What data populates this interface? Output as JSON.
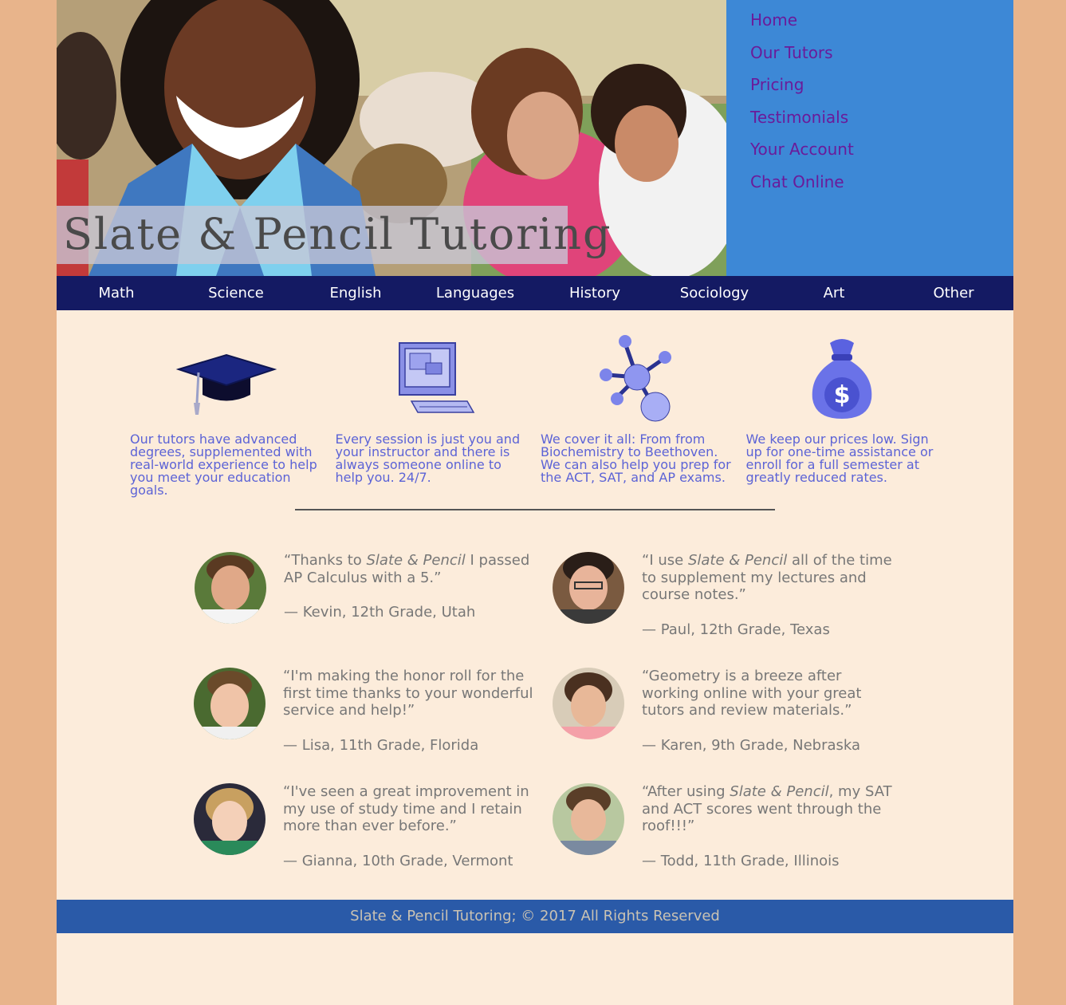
{
  "header": {
    "logo_text": "Slate & Pencil Tutoring"
  },
  "topnav": {
    "items": [
      "Home",
      "Our Tutors",
      "Pricing",
      "Testimonials",
      "Your Account",
      "Chat Online"
    ]
  },
  "subjects": {
    "items": [
      "Math",
      "Science",
      "English",
      "Languages",
      "History",
      "Sociology",
      "Art",
      "Other"
    ]
  },
  "features": [
    {
      "icon": "graduation-cap-icon",
      "text": "Our tutors have advanced degrees, supplemented with real-world experience to help you meet your education goals."
    },
    {
      "icon": "computer-icon",
      "text": "Every session is just you and your instructor and there is always someone online to help you. 24/7."
    },
    {
      "icon": "molecule-icon",
      "text": "We cover it all: From from Biochemistry to Beethoven. We can also help you prep for the ACT, SAT, and AP exams."
    },
    {
      "icon": "money-bag-icon",
      "text": "We keep our prices low. Sign up for one-time assistance or enroll for a full semester at greatly reduced rates."
    }
  ],
  "testimonials": [
    {
      "pre": "“Thanks to ",
      "em": "Slate & Pencil",
      "post": " I passed AP Calculus with a 5.”",
      "author": "— Kevin, 12th Grade, Utah"
    },
    {
      "pre": "“I use ",
      "em": "Slate & Pencil",
      "post": " all of the time to supplement my lectures and course notes.”",
      "author": "— Paul, 12th Grade, Texas"
    },
    {
      "pre": "“I'm making the honor roll for the first time thanks to your wonderful service and help!”",
      "em": "",
      "post": "",
      "author": "— Lisa, 11th Grade, Florida"
    },
    {
      "pre": "“Geometry is a breeze after working online with your great tutors and review materials.”",
      "em": "",
      "post": "",
      "author": "— Karen, 9th Grade, Nebraska"
    },
    {
      "pre": "“I've seen a great improvement in my use of study time and I retain more than ever before.”",
      "em": "",
      "post": "",
      "author": "— Gianna, 10th Grade, Vermont"
    },
    {
      "pre": "“After using ",
      "em": "Slate & Pencil",
      "post": ", my SAT and ACT scores went through the roof!!!”",
      "author": "— Todd, 11th Grade, Illinois"
    }
  ],
  "footer": {
    "text": "Slate & Pencil Tutoring; © 2017 All Rights Reserved"
  },
  "colors": {
    "outer_bg": "#e8b48b",
    "page_bg": "#fcecdb",
    "topnav_bg": "#3d88d6",
    "topnav_link": "#6a1b9a",
    "subject_bar": "#141a63",
    "feature_text": "#5c63d6",
    "footer_bg": "#2a5aa8"
  }
}
